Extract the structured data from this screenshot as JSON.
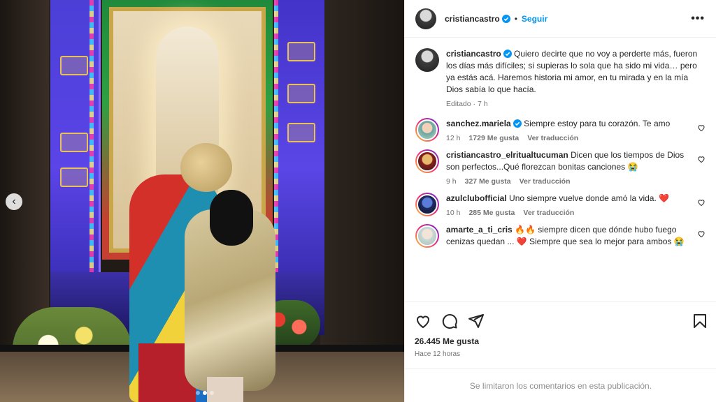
{
  "post": {
    "author": "cristiancastro",
    "follow_label": "Seguir",
    "separator": "•",
    "more_label": "•••",
    "caption": "Quiero decirte que no voy a perderte más, fueron los días más difíciles; si supieras lo sola que ha sido mi vida… pero ya estás acá. Haremos historia mi amor, en tu mirada y en la mía Dios sabía lo que hacía.",
    "caption_meta": "Editado · 7 h",
    "likes": "26.445 Me gusta",
    "time_ago": "Hace 12 horas",
    "comments_limited": "Se limitaron los comentarios en esta publicación."
  },
  "comments": [
    {
      "user": "sanchez.mariela",
      "verified": true,
      "text": "Siempre estoy para tu corazón. Te amo",
      "age": "12 h",
      "likes": "1729 Me gusta",
      "translate": "Ver traducción"
    },
    {
      "user": "cristiancastro_elritualtucuman",
      "verified": false,
      "text": "Dicen que los tiempos de Dios son perfectos...Qué florezcan bonitas canciones 😭",
      "age": "9 h",
      "likes": "327 Me gusta",
      "translate": "Ver traducción"
    },
    {
      "user": "azulclubofficial",
      "verified": false,
      "text": "Uno siempre vuelve donde amó la vida. ❤️",
      "age": "10 h",
      "likes": "285 Me gusta",
      "translate": "Ver traducción"
    },
    {
      "user": "amarte_a_ti_cris",
      "verified": false,
      "text": "🔥🔥 siempre dicen que dónde hubo fuego cenizas quedan ... ❤️ Siempre que sea lo mejor para ambos 😭",
      "age": "",
      "likes": "",
      "translate": ""
    }
  ],
  "carousel": {
    "prev_label": "‹",
    "slide_count": 3,
    "active_slide": 1
  },
  "colors": {
    "accent": "#0095f6",
    "verified": "#0095f6",
    "text": "#262626",
    "muted": "#737373"
  },
  "icons": [
    "verified-badge-icon",
    "heart-icon",
    "comment-icon",
    "share-icon",
    "bookmark-icon",
    "more-icon",
    "chevron-left-icon"
  ]
}
